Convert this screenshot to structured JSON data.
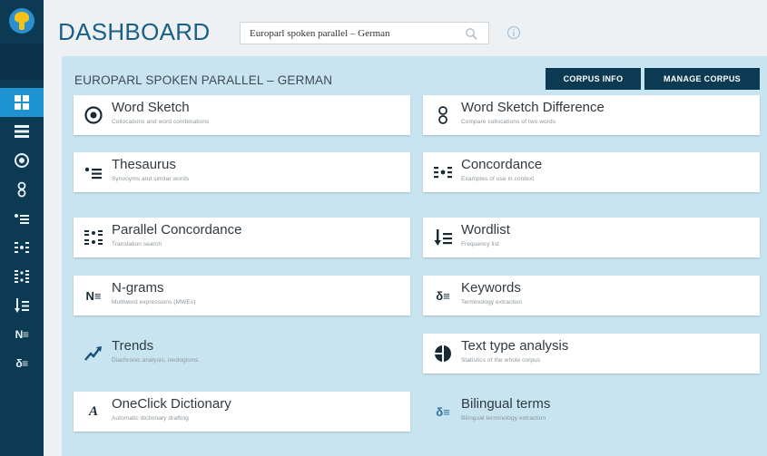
{
  "header": {
    "title": "DASHBOARD",
    "search_value": "Europarl spoken parallel – German"
  },
  "panel": {
    "title": "EUROPARL SPOKEN PARALLEL – GERMAN",
    "corpus_info_label": "CORPUS INFO",
    "manage_corpus_label": "MANAGE CORPUS"
  },
  "sidebar": {
    "items": [
      {
        "icon": "dashboard-icon"
      },
      {
        "icon": "list-icon"
      },
      {
        "icon": "word-sketch-icon"
      },
      {
        "icon": "word-sketch-difference-icon"
      },
      {
        "icon": "thesaurus-icon"
      },
      {
        "icon": "concordance-icon"
      },
      {
        "icon": "parallel-concordance-icon"
      },
      {
        "icon": "wordlist-icon"
      },
      {
        "icon": "ngrams-icon",
        "text": "N≡"
      },
      {
        "icon": "keywords-icon",
        "text": "δ≡"
      }
    ]
  },
  "cards": [
    {
      "title": "Word Sketch",
      "subtitle": "Collocations and word combinations",
      "icon": "word-sketch-icon"
    },
    {
      "title": "Word Sketch Difference",
      "subtitle": "Compare collocations of two words",
      "icon": "word-sketch-difference-icon"
    },
    {
      "title": "Thesaurus",
      "subtitle": "Synonyms and similar words",
      "icon": "thesaurus-icon"
    },
    {
      "title": "Concordance",
      "subtitle": "Examples of use in context",
      "icon": "concordance-icon"
    },
    {
      "title": "Parallel Concordance",
      "subtitle": "Translation search",
      "icon": "parallel-concordance-icon"
    },
    {
      "title": "Wordlist",
      "subtitle": "Frequency list",
      "icon": "wordlist-icon"
    },
    {
      "title": "N-grams",
      "subtitle": "Multiword expressions (MWEs)",
      "icon": "ngrams-icon",
      "icon_text": "N≡"
    },
    {
      "title": "Keywords",
      "subtitle": "Terminology extraction",
      "icon": "keywords-icon",
      "icon_text": "δ≡"
    },
    {
      "title": "Trends",
      "subtitle": "Diachronic analysis, neologisms",
      "icon": "trends-icon"
    },
    {
      "title": "Text type analysis",
      "subtitle": "Statistics of the whole corpus",
      "icon": "pie-chart-icon"
    },
    {
      "title": "OneClick Dictionary",
      "subtitle": "Automatic dictionary drafting",
      "icon": "dictionary-icon",
      "icon_text": "A"
    },
    {
      "title": "Bilingual terms",
      "subtitle": "Bilingual terminology extraction",
      "icon": "bilingual-terms-icon",
      "icon_text": "δ≡"
    }
  ],
  "colors": {
    "sidebar": "#0c3a52",
    "active": "#1f93cf",
    "panel": "#c9e4f1",
    "button": "#0c3a52",
    "title": "#1b5e86"
  }
}
